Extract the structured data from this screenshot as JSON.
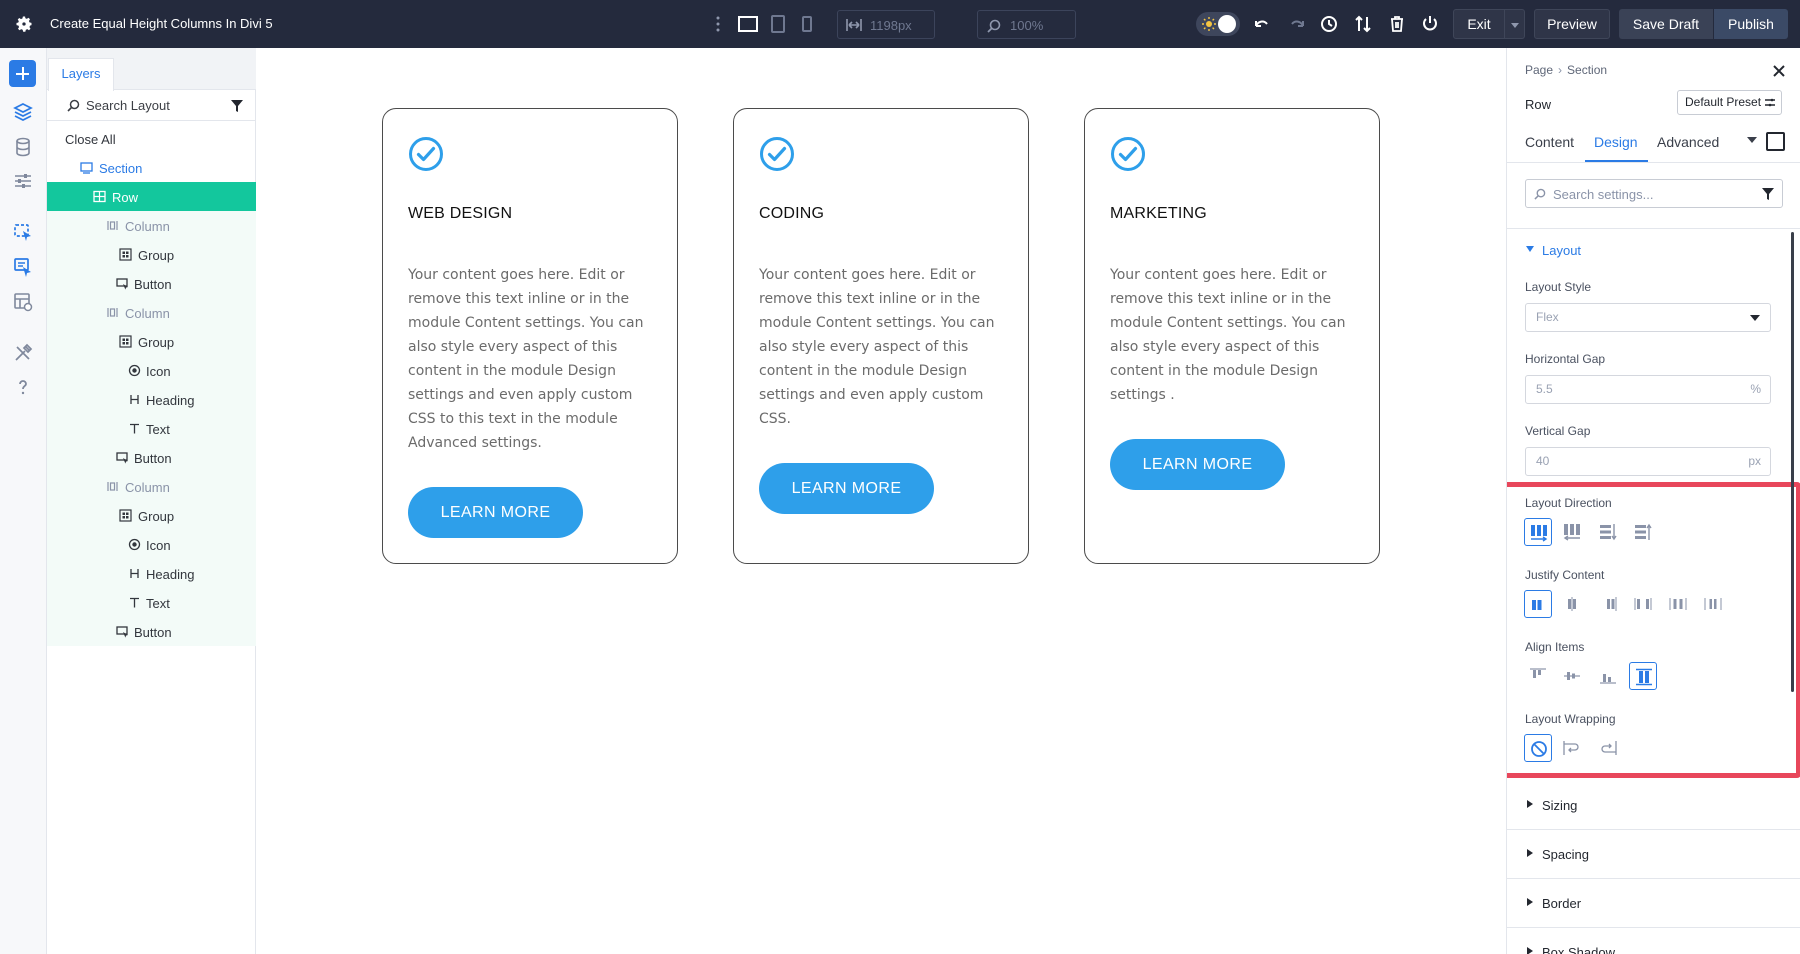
{
  "topbar": {
    "title": "Create Equal Height Columns In Divi 5",
    "width_value": "1198px",
    "zoom_value": "100%",
    "exit_label": "Exit",
    "preview_label": "Preview",
    "save_draft_label": "Save Draft",
    "publish_label": "Publish"
  },
  "layers": {
    "tab_label": "Layers",
    "search_placeholder": "Search Layout",
    "close_all": "Close All",
    "tree": [
      {
        "label": "Section",
        "icon": "section-icon"
      },
      {
        "label": "Row",
        "icon": "row-icon"
      },
      {
        "label": "Column",
        "icon": "column-icon"
      },
      {
        "label": "Group",
        "icon": "group-icon"
      },
      {
        "label": "Button",
        "icon": "button-icon"
      },
      {
        "label": "Column",
        "icon": "column-icon"
      },
      {
        "label": "Group",
        "icon": "group-icon"
      },
      {
        "label": "Icon",
        "icon": "circle-icon"
      },
      {
        "label": "Heading",
        "icon": "heading-icon"
      },
      {
        "label": "Text",
        "icon": "text-icon"
      },
      {
        "label": "Button",
        "icon": "button-icon"
      },
      {
        "label": "Column",
        "icon": "column-icon"
      },
      {
        "label": "Group",
        "icon": "group-icon"
      },
      {
        "label": "Icon",
        "icon": "circle-icon"
      },
      {
        "label": "Heading",
        "icon": "heading-icon"
      },
      {
        "label": "Text",
        "icon": "text-icon"
      },
      {
        "label": "Button",
        "icon": "button-icon"
      }
    ]
  },
  "canvas": {
    "cards": [
      {
        "heading": "WEB DESIGN",
        "body": "Your content goes here. Edit or remove this text inline or in the module Content settings. You can also style every aspect of this content in the module Design settings and even apply custom CSS to this text in the module Advanced settings.",
        "button": "LEARN MORE"
      },
      {
        "heading": "CODING",
        "body": "Your content goes here. Edit or remove this text inline or in the module Content settings. You can also style every aspect of this content in the module Design settings and even apply custom CSS.",
        "button": "LEARN MORE"
      },
      {
        "heading": "MARKETING",
        "body": "Your content goes here. Edit or remove this text inline or in the module Content settings. You can also style every aspect of this content in the module Design settings .",
        "button": "LEARN MORE"
      }
    ]
  },
  "settings": {
    "breadcrumb": [
      "Page",
      "Section"
    ],
    "element_name": "Row",
    "preset_label": "Default Preset",
    "tabs": [
      "Content",
      "Design",
      "Advanced"
    ],
    "active_tab": "Design",
    "search_placeholder": "Search settings...",
    "layout": {
      "title": "Layout",
      "layout_style_label": "Layout Style",
      "layout_style_value": "Flex",
      "horizontal_gap_label": "Horizontal Gap",
      "horizontal_gap_value": "5.5",
      "horizontal_gap_unit": "%",
      "vertical_gap_label": "Vertical Gap",
      "vertical_gap_value": "40",
      "vertical_gap_unit": "px",
      "layout_direction_label": "Layout Direction",
      "justify_content_label": "Justify Content",
      "align_items_label": "Align Items",
      "layout_wrapping_label": "Layout Wrapping"
    },
    "collapsed_groups": [
      "Sizing",
      "Spacing",
      "Border",
      "Box Shadow"
    ]
  },
  "colors": {
    "accent": "#2b7be5",
    "selected_layer": "#13c79d",
    "cta_button": "#2e9fea",
    "highlight": "#e8475b",
    "topbar": "#242a3d"
  }
}
